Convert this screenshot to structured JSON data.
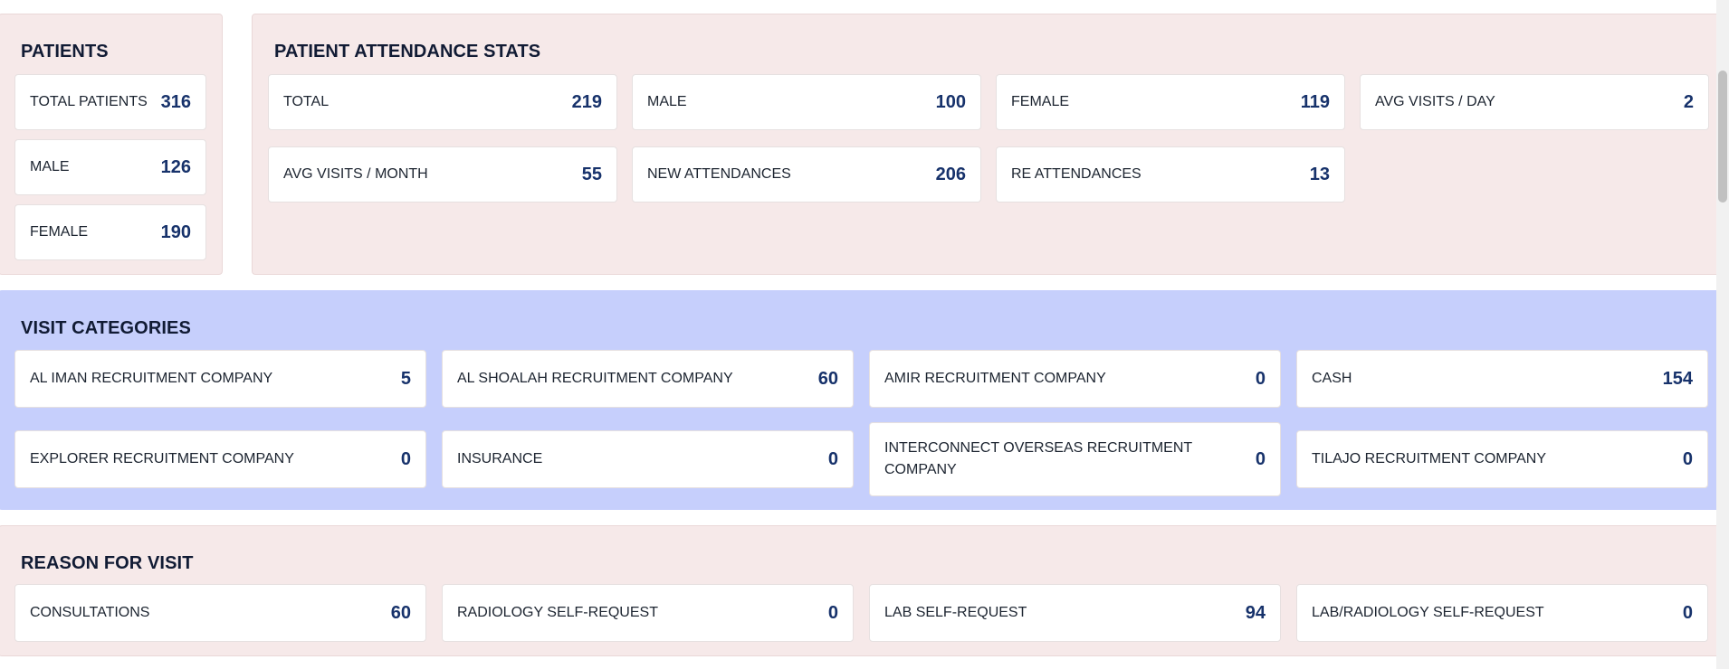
{
  "patients": {
    "title": "PATIENTS",
    "items": [
      {
        "label": "TOTAL PATIENTS",
        "value": "316"
      },
      {
        "label": "MALE",
        "value": "126"
      },
      {
        "label": "FEMALE",
        "value": "190"
      }
    ]
  },
  "attendance": {
    "title": "PATIENT ATTENDANCE STATS",
    "items": [
      {
        "label": "TOTAL",
        "value": "219"
      },
      {
        "label": "MALE",
        "value": "100"
      },
      {
        "label": "FEMALE",
        "value": "119"
      },
      {
        "label": "AVG VISITS / DAY",
        "value": "2"
      },
      {
        "label": "AVG VISITS / MONTH",
        "value": "55"
      },
      {
        "label": "NEW ATTENDANCES",
        "value": "206"
      },
      {
        "label": "RE ATTENDANCES",
        "value": "13"
      }
    ]
  },
  "categories": {
    "title": "VISIT CATEGORIES",
    "items": [
      {
        "label": "AL IMAN RECRUITMENT COMPANY",
        "value": "5"
      },
      {
        "label": "AL SHOALAH RECRUITMENT COMPANY",
        "value": "60"
      },
      {
        "label": "AMIR RECRUITMENT COMPANY",
        "value": "0"
      },
      {
        "label": "CASH",
        "value": "154"
      },
      {
        "label": "EXPLORER RECRUITMENT COMPANY",
        "value": "0"
      },
      {
        "label": "INSURANCE",
        "value": "0"
      },
      {
        "label": "INTERCONNECT OVERSEAS RECRUITMENT COMPANY",
        "value": "0"
      },
      {
        "label": "TILAJO RECRUITMENT COMPANY",
        "value": "0"
      }
    ]
  },
  "reasons": {
    "title": "REASON FOR VISIT",
    "items": [
      {
        "label": "CONSULTATIONS",
        "value": "60"
      },
      {
        "label": "RADIOLOGY SELF-REQUEST",
        "value": "0"
      },
      {
        "label": "LAB SELF-REQUEST",
        "value": "94"
      },
      {
        "label": "LAB/RADIOLOGY SELF-REQUEST",
        "value": "0"
      }
    ]
  },
  "colors": {
    "panel_pink": "#f6e9e9",
    "panel_blue": "#c6cffc",
    "value_text": "#17326b"
  }
}
